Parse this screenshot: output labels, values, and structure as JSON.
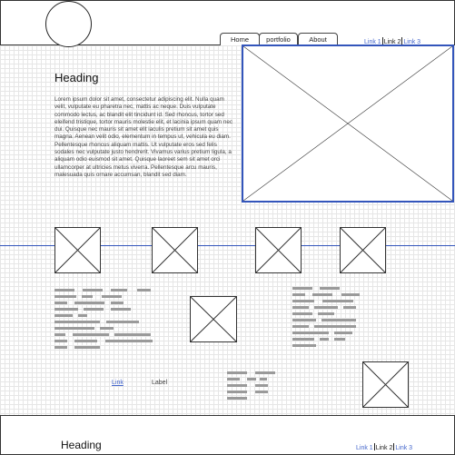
{
  "nav": {
    "tabs": [
      {
        "label": "Home"
      },
      {
        "label": "portfolio"
      },
      {
        "label": "About"
      }
    ],
    "links": [
      {
        "label": "Link 1"
      },
      {
        "label": "Link 2"
      },
      {
        "label": "Link 3"
      }
    ]
  },
  "hero": {
    "heading": "Heading",
    "body": "Lorem ipsum dolor sit amet, consectetur adipiscing elit. Nulla quam velit, vulputate eu pharetra nec, mattis ac neque. Duis vulputate commodo lectus, ac blandit elit tincidunt id. Sed rhoncus, tortor sed eleifend tristique, tortor mauris molestie elit, et lacinia ipsum quam nec dui. Quisque nec mauris sit amet elit iaculis pretium sit amet quis magna. Aenean velit odio, elementum in tempus ut, vehicula eu diam. Pellentesque rhoncus aliquam mattis. Ut vulputate eros sed felis sodales nec vulputate justo hendrerit. Vivamus varius pretium ligula, a aliquam odio euismod sit amet. Quisque laoreet sem sit amet orci ullamcorper at ultricies metus viverra. Pellentesque arcu mauris, malesuada quis ornare accumsan, blandit sed diam."
  },
  "content": {
    "link_label": "Link",
    "label_text": "Label"
  },
  "footer": {
    "heading": "Heading",
    "links": [
      {
        "label": "Link 1"
      },
      {
        "label": "Link 2"
      },
      {
        "label": "Link 3"
      }
    ]
  },
  "colors": {
    "link": "#4466cc",
    "rule": "#3355bb",
    "placeholder_bar": "#9a9a9a"
  },
  "icons": {
    "image_placeholder": "image-placeholder-icon"
  }
}
